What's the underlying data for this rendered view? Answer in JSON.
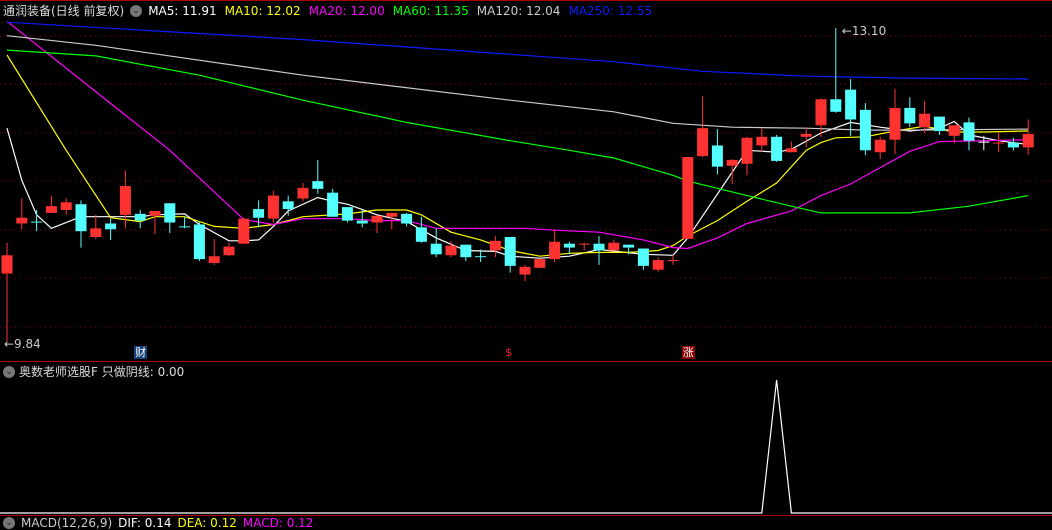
{
  "header": {
    "title": "通润装备(日线 前复权)",
    "ma": [
      {
        "label": "MA5: 11.91",
        "color": "#ffffff"
      },
      {
        "label": "MA10: 12.02",
        "color": "#ffff00"
      },
      {
        "label": "MA20: 12.00",
        "color": "#ff00ff"
      },
      {
        "label": "MA60: 11.35",
        "color": "#00ff00"
      },
      {
        "label": "MA120: 12.04",
        "color": "#cccccc"
      },
      {
        "label": "MA250: 12.55",
        "color": "#0a1cff"
      }
    ]
  },
  "annotations": {
    "high_label": "13.10",
    "low_label": "9.84"
  },
  "markers": [
    {
      "text": "财",
      "candle": 9,
      "bg": "#123f78",
      "color": "#ffffff"
    },
    {
      "text": "$",
      "candle": 34,
      "bg": "transparent",
      "color": "#ff2020"
    },
    {
      "text": "涨",
      "candle": 46,
      "bg": "#8b0000",
      "color": "#ffffff"
    }
  ],
  "indicator": {
    "label": "奥数老师选股F  只做阴线: 0.00",
    "values_nonzero": [
      [
        52,
        1
      ]
    ]
  },
  "macd": {
    "name": "MACD(12,26,9)",
    "dif": "DIF: 0.14",
    "dea": "DEA: 0.12",
    "macd": "MACD: 0.12"
  },
  "colors": {
    "up": "#ff3232",
    "down": "#54ffff",
    "flat": "#ffffff",
    "grid": "#8b0000"
  },
  "chart_data": {
    "type": "candlestick",
    "ylim": [
      9.84,
      13.1
    ],
    "candles_ohlc": [
      [
        10.55,
        10.74,
        10.87,
        9.84
      ],
      [
        11.07,
        11.13,
        11.33,
        11.01
      ],
      [
        11.09,
        11.09,
        11.21,
        10.99
      ],
      [
        11.18,
        11.25,
        11.36,
        11.18
      ],
      [
        11.21,
        11.29,
        11.33,
        11.16
      ],
      [
        11.27,
        10.99,
        11.31,
        10.82
      ],
      [
        10.93,
        11.02,
        11.16,
        10.91
      ],
      [
        11.07,
        11.01,
        11.12,
        10.9
      ],
      [
        11.16,
        11.46,
        11.62,
        11.02
      ],
      [
        11.17,
        11.1,
        11.21,
        11.02
      ],
      [
        11.15,
        11.2,
        11.2,
        10.96
      ],
      [
        11.28,
        11.08,
        11.28,
        10.97
      ],
      [
        11.04,
        11.04,
        11.14,
        11.02
      ],
      [
        11.06,
        10.7,
        11.09,
        10.68
      ],
      [
        10.66,
        10.73,
        10.91,
        10.64
      ],
      [
        10.74,
        10.83,
        10.87,
        10.73
      ],
      [
        10.86,
        11.12,
        11.13,
        10.86
      ],
      [
        11.22,
        11.13,
        11.31,
        11.03
      ],
      [
        11.12,
        11.36,
        11.41,
        11.08
      ],
      [
        11.3,
        11.22,
        11.36,
        11.15
      ],
      [
        11.33,
        11.44,
        11.49,
        11.3
      ],
      [
        11.51,
        11.43,
        11.73,
        11.38
      ],
      [
        11.39,
        11.14,
        11.43,
        11.14
      ],
      [
        11.24,
        11.1,
        11.24,
        11.08
      ],
      [
        11.1,
        11.07,
        11.21,
        11.03
      ],
      [
        11.08,
        11.15,
        11.15,
        10.97
      ],
      [
        11.14,
        11.18,
        11.18,
        11.01
      ],
      [
        11.17,
        11.07,
        11.18,
        11.04
      ],
      [
        11.03,
        10.88,
        11.14,
        10.87
      ],
      [
        10.86,
        10.75,
        11.02,
        10.72
      ],
      [
        10.74,
        10.84,
        10.89,
        10.72
      ],
      [
        10.85,
        10.72,
        10.85,
        10.68
      ],
      [
        10.73,
        10.73,
        10.8,
        10.67
      ],
      [
        10.79,
        10.89,
        10.94,
        10.72
      ],
      [
        10.93,
        10.63,
        10.93,
        10.56
      ],
      [
        10.54,
        10.62,
        10.64,
        10.47
      ],
      [
        10.61,
        10.7,
        10.7,
        10.61
      ],
      [
        10.7,
        10.88,
        11.01,
        10.67
      ],
      [
        10.86,
        10.82,
        10.88,
        10.75
      ],
      [
        10.86,
        10.86,
        10.87,
        10.79
      ],
      [
        10.86,
        10.79,
        10.94,
        10.64
      ],
      [
        10.79,
        10.87,
        10.9,
        10.79
      ],
      [
        10.85,
        10.82,
        10.85,
        10.75
      ],
      [
        10.81,
        10.63,
        10.81,
        10.59
      ],
      [
        10.59,
        10.69,
        10.72,
        10.57
      ],
      [
        10.69,
        10.69,
        10.74,
        10.64
      ],
      [
        10.91,
        11.76,
        11.76,
        10.91
      ],
      [
        11.77,
        12.06,
        12.39,
        11.76
      ],
      [
        11.88,
        11.66,
        12.05,
        11.58
      ],
      [
        11.67,
        11.73,
        11.74,
        11.48
      ],
      [
        11.69,
        11.96,
        11.97,
        11.57
      ],
      [
        11.88,
        11.97,
        12.06,
        11.81
      ],
      [
        11.97,
        11.72,
        11.99,
        11.71
      ],
      [
        11.81,
        11.85,
        11.92,
        11.81
      ],
      [
        11.97,
        12.0,
        12.07,
        11.86
      ],
      [
        12.09,
        12.36,
        12.37,
        11.97
      ],
      [
        12.36,
        12.23,
        13.1,
        12.22
      ],
      [
        12.46,
        12.15,
        12.57,
        11.98
      ],
      [
        12.25,
        11.83,
        12.32,
        11.78
      ],
      [
        11.81,
        11.94,
        11.97,
        11.74
      ],
      [
        11.94,
        12.27,
        12.47,
        11.79
      ],
      [
        12.27,
        12.11,
        12.38,
        12.07
      ],
      [
        12.07,
        12.21,
        12.34,
        12.01
      ],
      [
        12.18,
        12.03,
        12.18,
        11.99
      ],
      [
        11.98,
        12.09,
        12.09,
        11.9
      ],
      [
        12.12,
        11.93,
        12.17,
        11.83
      ],
      [
        11.92,
        11.92,
        11.98,
        11.83
      ],
      [
        11.91,
        11.91,
        12.02,
        11.81
      ],
      [
        11.91,
        11.86,
        11.96,
        11.83
      ],
      [
        11.86,
        12.0,
        12.15,
        11.78
      ]
    ],
    "series": [
      {
        "name": "MA5",
        "color": "#ffffff",
        "points": [
          [
            0,
            12.06
          ],
          [
            1,
            11.52
          ],
          [
            2,
            11.16
          ],
          [
            3,
            11.02
          ],
          [
            5,
            11.14
          ],
          [
            9,
            11.14
          ],
          [
            10,
            11.16
          ],
          [
            12,
            11.17
          ],
          [
            13,
            11.06
          ],
          [
            15,
            10.89
          ],
          [
            16,
            10.89
          ],
          [
            17,
            10.9
          ],
          [
            18,
            11.04
          ],
          [
            19,
            11.2
          ],
          [
            21,
            11.34
          ],
          [
            22,
            11.3
          ],
          [
            23,
            11.27
          ],
          [
            25,
            11.16
          ],
          [
            27,
            11.09
          ],
          [
            29,
            10.92
          ],
          [
            31,
            10.79
          ],
          [
            33,
            10.78
          ],
          [
            34,
            10.73
          ],
          [
            36,
            10.71
          ],
          [
            38,
            10.73
          ],
          [
            40,
            10.8
          ],
          [
            43,
            10.75
          ],
          [
            45,
            10.74
          ],
          [
            46,
            10.92
          ],
          [
            50,
            11.83
          ],
          [
            52,
            11.81
          ],
          [
            53,
            11.84
          ],
          [
            55,
            12.01
          ],
          [
            57,
            12.12
          ],
          [
            59,
            12.07
          ],
          [
            61,
            12.03
          ],
          [
            63,
            12.06
          ],
          [
            64,
            12.13
          ],
          [
            65,
            11.99
          ],
          [
            67,
            11.93
          ],
          [
            69,
            11.89
          ]
        ]
      },
      {
        "name": "MA10",
        "color": "#ffff00",
        "points": [
          [
            0,
            12.82
          ],
          [
            4,
            11.83
          ],
          [
            7,
            11.13
          ],
          [
            9,
            11.09
          ],
          [
            10,
            11.14
          ],
          [
            12,
            11.14
          ],
          [
            14,
            11.04
          ],
          [
            16,
            11.02
          ],
          [
            18,
            11.06
          ],
          [
            20,
            11.14
          ],
          [
            23,
            11.17
          ],
          [
            25,
            11.21
          ],
          [
            27,
            11.21
          ],
          [
            28,
            11.16
          ],
          [
            30,
            10.98
          ],
          [
            32,
            10.9
          ],
          [
            34,
            10.79
          ],
          [
            36,
            10.73
          ],
          [
            38,
            10.76
          ],
          [
            40,
            10.77
          ],
          [
            42,
            10.77
          ],
          [
            44,
            10.79
          ],
          [
            45,
            10.84
          ],
          [
            46,
            10.94
          ],
          [
            48,
            11.1
          ],
          [
            50,
            11.3
          ],
          [
            52,
            11.49
          ],
          [
            54,
            11.83
          ],
          [
            55,
            11.91
          ],
          [
            56,
            11.96
          ],
          [
            58,
            11.97
          ],
          [
            60,
            12.03
          ],
          [
            62,
            12.08
          ],
          [
            64,
            12.02
          ],
          [
            66,
            12.02
          ],
          [
            69,
            12.03
          ]
        ]
      },
      {
        "name": "MA20",
        "color": "#ff00ff",
        "points": [
          [
            0,
            13.17
          ],
          [
            11,
            11.83
          ],
          [
            16,
            11.11
          ],
          [
            18,
            11.06
          ],
          [
            20,
            11.12
          ],
          [
            23,
            11.12
          ],
          [
            25,
            11.1
          ],
          [
            27,
            11.1
          ],
          [
            29,
            11.02
          ],
          [
            32,
            11.02
          ],
          [
            35,
            11.02
          ],
          [
            37,
            11.0
          ],
          [
            40,
            10.98
          ],
          [
            43,
            10.9
          ],
          [
            45,
            10.82
          ],
          [
            46,
            10.81
          ],
          [
            48,
            10.92
          ],
          [
            50,
            11.07
          ],
          [
            53,
            11.2
          ],
          [
            55,
            11.36
          ],
          [
            57,
            11.48
          ],
          [
            59,
            11.65
          ],
          [
            61,
            11.82
          ],
          [
            63,
            11.92
          ],
          [
            66,
            11.93
          ],
          [
            69,
            11.94
          ]
        ]
      },
      {
        "name": "MA60",
        "color": "#00ff00",
        "points": [
          [
            0,
            12.87
          ],
          [
            6,
            12.81
          ],
          [
            13,
            12.61
          ],
          [
            20,
            12.35
          ],
          [
            27,
            12.12
          ],
          [
            34,
            11.93
          ],
          [
            38,
            11.83
          ],
          [
            41,
            11.75
          ],
          [
            45,
            11.57
          ],
          [
            46,
            11.51
          ],
          [
            50,
            11.36
          ],
          [
            53,
            11.25
          ],
          [
            55,
            11.18
          ],
          [
            58,
            11.18
          ],
          [
            61,
            11.18
          ],
          [
            65,
            11.25
          ],
          [
            69,
            11.36
          ]
        ]
      },
      {
        "name": "MA120",
        "color": "#cccccc",
        "points": [
          [
            0,
            13.02
          ],
          [
            6,
            12.92
          ],
          [
            20,
            12.61
          ],
          [
            34,
            12.35
          ],
          [
            41,
            12.23
          ],
          [
            45,
            12.11
          ],
          [
            49,
            12.07
          ],
          [
            54,
            12.06
          ],
          [
            58,
            12.04
          ],
          [
            61,
            12.04
          ],
          [
            69,
            12.05
          ]
        ]
      },
      {
        "name": "MA250",
        "color": "#0a1cff",
        "points": [
          [
            0,
            13.16
          ],
          [
            20,
            12.98
          ],
          [
            41,
            12.75
          ],
          [
            47,
            12.65
          ],
          [
            54,
            12.6
          ],
          [
            61,
            12.58
          ],
          [
            69,
            12.57
          ]
        ]
      }
    ]
  }
}
